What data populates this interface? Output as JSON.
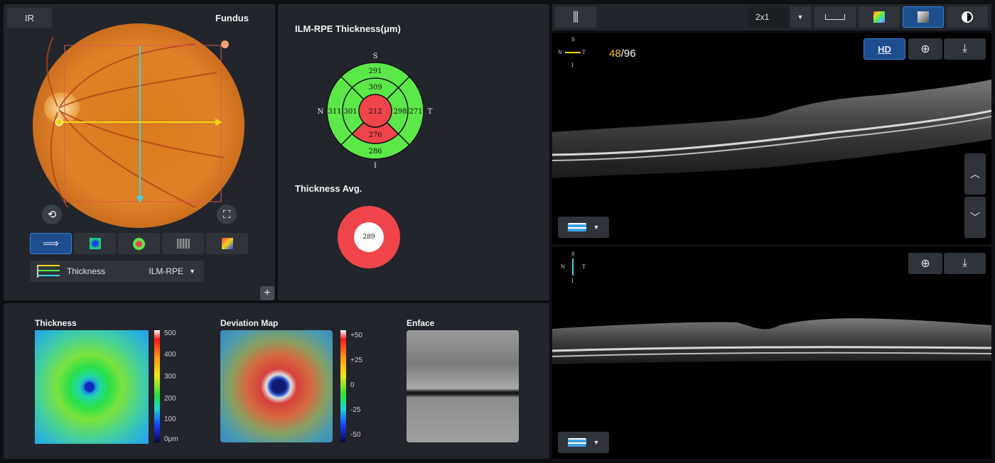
{
  "fundus_panel": {
    "ir_tab": "IR",
    "title": "Fundus",
    "view_buttons": [
      "line-scan",
      "thickness-map",
      "etdrs-grid",
      "enface-grid",
      "deviation-map"
    ],
    "layer_selector": {
      "label": "Thickness",
      "value": "ILM-RPE"
    },
    "add_button": "+"
  },
  "etdrs": {
    "title": "ILM-RPE Thickness(μm)",
    "orientation": {
      "top": "S",
      "bottom": "I",
      "left": "N",
      "right": "T"
    },
    "values": {
      "outer_superior": "291",
      "inner_superior": "309",
      "outer_nasal": "311",
      "inner_nasal": "301",
      "center": "212",
      "inner_temporal": "298",
      "outer_temporal": "271",
      "inner_inferior": "276",
      "outer_inferior": "286"
    },
    "colors": {
      "normal": "#5de84a",
      "low": "#f0454b"
    },
    "avg_title": "Thickness Avg.",
    "avg_value": "289"
  },
  "maps": {
    "thickness": {
      "title": "Thickness",
      "scale": [
        "500",
        "400",
        "300",
        "200",
        "100",
        "0μm"
      ]
    },
    "deviation": {
      "title": "Deviation Map",
      "scale": [
        "+50",
        "+25",
        "0",
        "-25",
        "-50"
      ]
    },
    "enface": {
      "title": "Enface"
    }
  },
  "toolbar": {
    "layout_value": "2x1",
    "buttons": [
      "adjust-icon",
      "caliper-icon",
      "color-palette-icon",
      "grayscale-icon",
      "invert-icon"
    ]
  },
  "bscan_top": {
    "orientation": {
      "top": "S",
      "bottom": "I",
      "left": "N",
      "right": "T"
    },
    "slice_current": "48",
    "slice_total": "/96",
    "hd_label": "HD"
  },
  "bscan_bottom": {
    "orientation": {
      "top": "S",
      "bottom": "I",
      "left": "N",
      "right": "T"
    }
  },
  "accent": {
    "yellow": "#f5c518",
    "cyan": "#3fd3e8",
    "blue_selected": "#1d4f8f"
  }
}
